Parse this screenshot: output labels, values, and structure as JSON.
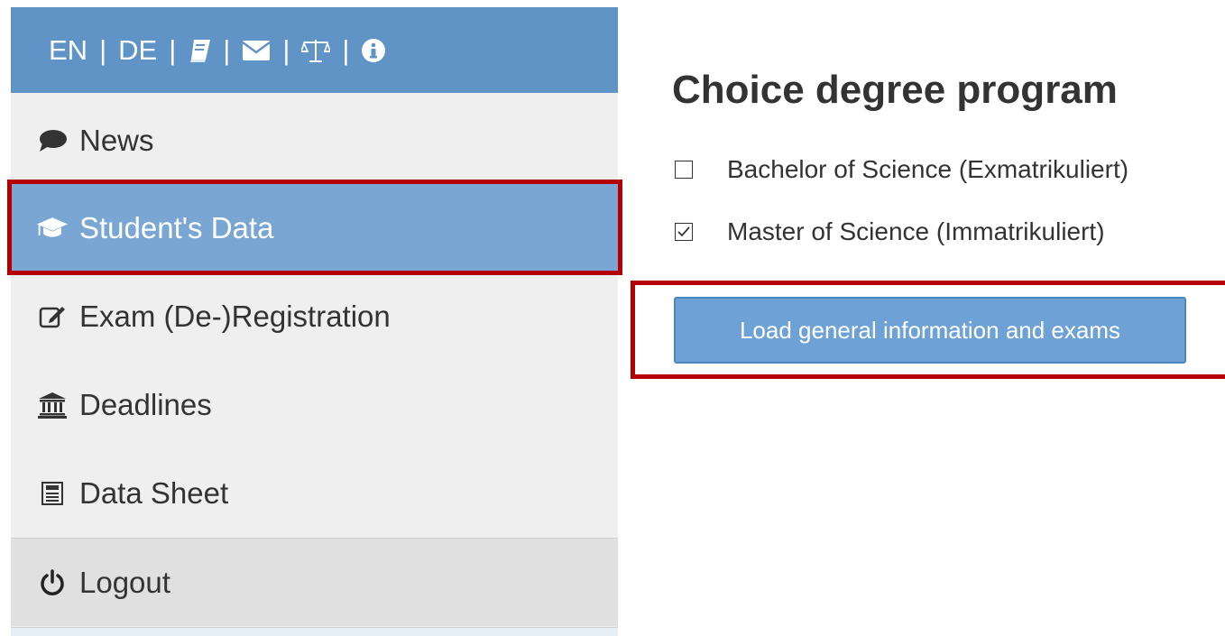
{
  "topbar": {
    "lang_en": "EN",
    "lang_de": "DE",
    "separator": "|",
    "icons": [
      "book-icon",
      "envelope-icon",
      "balance-scale-icon",
      "info-icon"
    ]
  },
  "sidebar": {
    "items": [
      {
        "label": "News",
        "icon": "comment-icon"
      },
      {
        "label": "Student's Data",
        "icon": "graduation-cap-icon",
        "active": true
      },
      {
        "label": "Exam (De-)Registration",
        "icon": "edit-icon"
      },
      {
        "label": "Deadlines",
        "icon": "institution-icon"
      },
      {
        "label": "Data Sheet",
        "icon": "data-sheet-icon"
      },
      {
        "label": "Logout",
        "icon": "power-icon"
      }
    ]
  },
  "main": {
    "title": "Choice degree program",
    "options": [
      {
        "label": "Bachelor of Science (Exmatrikuliert)",
        "checked": false
      },
      {
        "label": "Master of Science (Immatrikuliert)",
        "checked": true
      }
    ],
    "load_button": "Load general information and exams"
  },
  "colors": {
    "topbar": "#6194c6",
    "active_item": "#7aa6d4",
    "button": "#6ea2d6",
    "highlight": "#b50000"
  }
}
